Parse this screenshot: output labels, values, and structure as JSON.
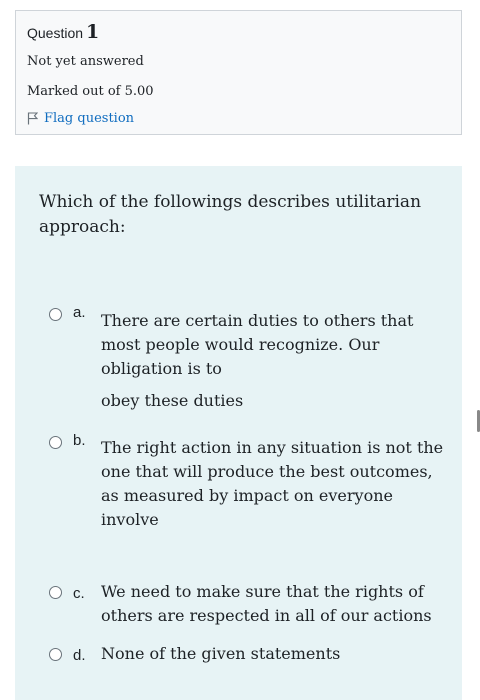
{
  "info": {
    "question_label": "Question",
    "question_number": "1",
    "state": "Not yet answered",
    "grade": "Marked out of 5.00",
    "flag_label": "Flag question"
  },
  "question": {
    "text": "Which of the followings describes utilitarian approach:"
  },
  "options": [
    {
      "letter": "a.",
      "lines": [
        "There are certain duties to others that most people would recognize. Our obligation is to",
        "obey these duties"
      ]
    },
    {
      "letter": "b.",
      "lines": [
        "The right action in any situation is not the one that will produce the best outcomes, as measured by impact on everyone involve"
      ]
    },
    {
      "letter": "c.",
      "lines": [
        "We need to make sure that the rights of others are respected in all of our actions"
      ]
    },
    {
      "letter": "d.",
      "lines": [
        "None of the given statements"
      ]
    }
  ],
  "colors": {
    "link": "#0f6cbf",
    "content_bg": "#e7f3f5",
    "info_bg": "#f8f9fa"
  },
  "icons": {
    "flag": "flag-icon",
    "radio": "radio-unchecked-icon"
  }
}
